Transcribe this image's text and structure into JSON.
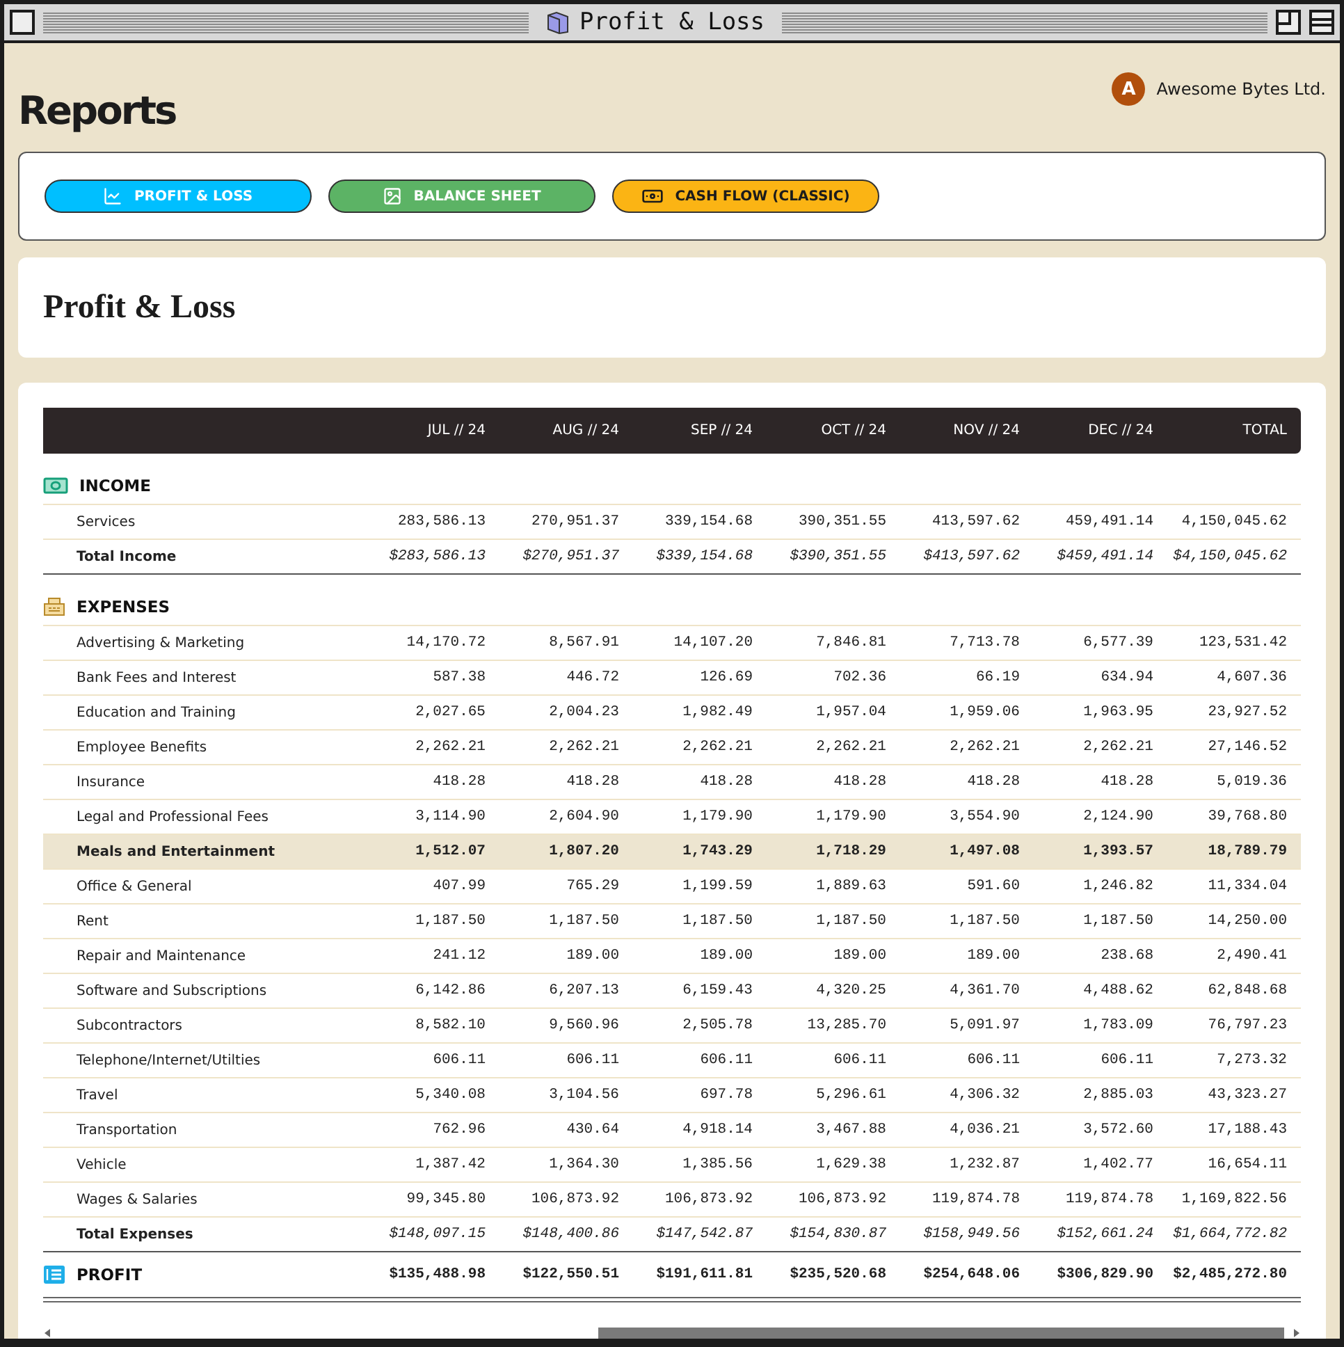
{
  "window": {
    "title": "Profit & Loss"
  },
  "header": {
    "title": "Reports",
    "company": {
      "initial": "A",
      "name": "Awesome Bytes Ltd."
    }
  },
  "report_buttons": [
    {
      "label": "PROFIT & LOSS",
      "kind": "chart",
      "color": "#00bfff"
    },
    {
      "label": "BALANCE SHEET",
      "kind": "image",
      "color": "#5cb365"
    },
    {
      "label": "CASH FLOW (CLASSIC)",
      "kind": "banknote",
      "color": "#fbb414"
    }
  ],
  "report": {
    "title": "Profit & Loss"
  },
  "table": {
    "columns": [
      "JUL // 24",
      "AUG // 24",
      "SEP // 24",
      "OCT // 24",
      "NOV // 24",
      "DEC // 24",
      "TOTAL"
    ],
    "sections": [
      {
        "kind": "income",
        "title": "INCOME",
        "rows": [
          {
            "label": "Services",
            "selected": false,
            "values": [
              "283,586.13",
              "270,951.37",
              "339,154.68",
              "390,351.55",
              "413,597.62",
              "459,491.14",
              "4,150,045.62"
            ]
          }
        ],
        "total": {
          "label": "Total Income",
          "values": [
            "$283,586.13",
            "$270,951.37",
            "$339,154.68",
            "$390,351.55",
            "$413,597.62",
            "$459,491.14",
            "$4,150,045.62"
          ]
        }
      },
      {
        "kind": "expenses",
        "title": "EXPENSES",
        "rows": [
          {
            "label": "Advertising & Marketing",
            "selected": false,
            "values": [
              "14,170.72",
              "8,567.91",
              "14,107.20",
              "7,846.81",
              "7,713.78",
              "6,577.39",
              "123,531.42"
            ]
          },
          {
            "label": "Bank Fees and Interest",
            "selected": false,
            "values": [
              "587.38",
              "446.72",
              "126.69",
              "702.36",
              "66.19",
              "634.94",
              "4,607.36"
            ]
          },
          {
            "label": "Education and Training",
            "selected": false,
            "values": [
              "2,027.65",
              "2,004.23",
              "1,982.49",
              "1,957.04",
              "1,959.06",
              "1,963.95",
              "23,927.52"
            ]
          },
          {
            "label": "Employee Benefits",
            "selected": false,
            "values": [
              "2,262.21",
              "2,262.21",
              "2,262.21",
              "2,262.21",
              "2,262.21",
              "2,262.21",
              "27,146.52"
            ]
          },
          {
            "label": "Insurance",
            "selected": false,
            "values": [
              "418.28",
              "418.28",
              "418.28",
              "418.28",
              "418.28",
              "418.28",
              "5,019.36"
            ]
          },
          {
            "label": "Legal and Professional Fees",
            "selected": false,
            "values": [
              "3,114.90",
              "2,604.90",
              "1,179.90",
              "1,179.90",
              "3,554.90",
              "2,124.90",
              "39,768.80"
            ]
          },
          {
            "label": "Meals and Entertainment",
            "selected": true,
            "values": [
              "1,512.07",
              "1,807.20",
              "1,743.29",
              "1,718.29",
              "1,497.08",
              "1,393.57",
              "18,789.79"
            ]
          },
          {
            "label": "Office & General",
            "selected": false,
            "values": [
              "407.99",
              "765.29",
              "1,199.59",
              "1,889.63",
              "591.60",
              "1,246.82",
              "11,334.04"
            ]
          },
          {
            "label": "Rent",
            "selected": false,
            "values": [
              "1,187.50",
              "1,187.50",
              "1,187.50",
              "1,187.50",
              "1,187.50",
              "1,187.50",
              "14,250.00"
            ]
          },
          {
            "label": "Repair and Maintenance",
            "selected": false,
            "values": [
              "241.12",
              "189.00",
              "189.00",
              "189.00",
              "189.00",
              "238.68",
              "2,490.41"
            ]
          },
          {
            "label": "Software and Subscriptions",
            "selected": false,
            "values": [
              "6,142.86",
              "6,207.13",
              "6,159.43",
              "4,320.25",
              "4,361.70",
              "4,488.62",
              "62,848.68"
            ]
          },
          {
            "label": "Subcontractors",
            "selected": false,
            "values": [
              "8,582.10",
              "9,560.96",
              "2,505.78",
              "13,285.70",
              "5,091.97",
              "1,783.09",
              "76,797.23"
            ]
          },
          {
            "label": "Telephone/Internet/Utilties",
            "selected": false,
            "values": [
              "606.11",
              "606.11",
              "606.11",
              "606.11",
              "606.11",
              "606.11",
              "7,273.32"
            ]
          },
          {
            "label": "Travel",
            "selected": false,
            "values": [
              "5,340.08",
              "3,104.56",
              "697.78",
              "5,296.61",
              "4,306.32",
              "2,885.03",
              "43,323.27"
            ]
          },
          {
            "label": "Transportation",
            "selected": false,
            "values": [
              "762.96",
              "430.64",
              "4,918.14",
              "3,467.88",
              "4,036.21",
              "3,572.60",
              "17,188.43"
            ]
          },
          {
            "label": "Vehicle",
            "selected": false,
            "values": [
              "1,387.42",
              "1,364.30",
              "1,385.56",
              "1,629.38",
              "1,232.87",
              "1,402.77",
              "16,654.11"
            ]
          },
          {
            "label": "Wages & Salaries",
            "selected": false,
            "values": [
              "99,345.80",
              "106,873.92",
              "106,873.92",
              "106,873.92",
              "119,874.78",
              "119,874.78",
              "1,169,822.56"
            ]
          }
        ],
        "total": {
          "label": "Total Expenses",
          "values": [
            "$148,097.15",
            "$148,400.86",
            "$147,542.87",
            "$154,830.87",
            "$158,949.56",
            "$152,661.24",
            "$1,664,772.82"
          ]
        }
      }
    ],
    "profit": {
      "label": "PROFIT",
      "values": [
        "$135,488.98",
        "$122,550.51",
        "$191,611.81",
        "$235,520.68",
        "$254,648.06",
        "$306,829.90",
        "$2,485,272.80"
      ]
    }
  }
}
